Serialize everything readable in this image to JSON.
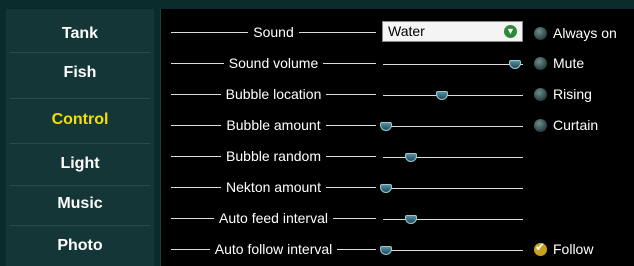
{
  "nav": {
    "items": [
      {
        "label": "Tank",
        "active": false
      },
      {
        "label": "Fish",
        "active": false
      },
      {
        "label": "Control",
        "active": true
      },
      {
        "label": "Light",
        "active": false
      },
      {
        "label": "Music",
        "active": false
      },
      {
        "label": "Photo",
        "active": false
      }
    ]
  },
  "settings": {
    "sound": {
      "label": "Sound",
      "value": "Water"
    },
    "sound_volume": {
      "label": "Sound volume",
      "level": 0.94
    },
    "bubble_location": {
      "label": "Bubble location",
      "level": 0.42
    },
    "bubble_amount": {
      "label": "Bubble amount",
      "level": 0.02
    },
    "bubble_random": {
      "label": "Bubble random",
      "level": 0.2
    },
    "nekton_amount": {
      "label": "Nekton amount",
      "level": 0.02
    },
    "auto_feed_interval": {
      "label": "Auto feed interval",
      "level": 0.2
    },
    "auto_follow_interval": {
      "label": "Auto follow interval",
      "level": 0.02
    }
  },
  "options": {
    "always_on": "Always on",
    "mute": "Mute",
    "rising": "Rising",
    "curtain": "Curtain",
    "follow": "Follow"
  },
  "colors": {
    "active_nav": "#f2e000",
    "frame": "#0a2a2c",
    "check": "#c8a21e"
  }
}
